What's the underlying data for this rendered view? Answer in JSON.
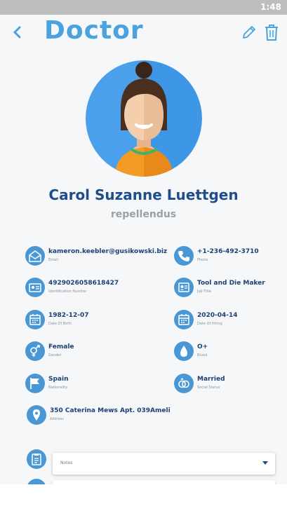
{
  "status_bar": {
    "time": "1:48"
  },
  "header": {
    "title": "Doctor"
  },
  "profile": {
    "name": "Carol Suzanne Luettgen",
    "role": "repellendus"
  },
  "fields": {
    "email": {
      "value": "kameron.keebler@gusikowski.biz",
      "label": "Email"
    },
    "phone": {
      "value": "+1-236-492-3710",
      "label": "Phone"
    },
    "id_number": {
      "value": "4929026058618427",
      "label": "Identification Number"
    },
    "job_title": {
      "value": "Tool and Die Maker",
      "label": "Job Title"
    },
    "dob": {
      "value": "1982-12-07",
      "label": "Date Of Birth"
    },
    "hiring": {
      "value": "2020-04-14",
      "label": "Date Of Hiring"
    },
    "gender": {
      "value": "Female",
      "label": "Gender"
    },
    "blood": {
      "value": "O+",
      "label": "Blood"
    },
    "nationality": {
      "value": "Spain",
      "label": "Nationality"
    },
    "social": {
      "value": "Married",
      "label": "Social Status"
    },
    "address": {
      "value": "350 Caterina Mews Apt. 039Ameli",
      "label": "Address"
    }
  },
  "notes": {
    "label": "Notes"
  },
  "colors": {
    "accent": "#4a97d6",
    "title": "#4aa3dd",
    "name": "#1e4d8c"
  },
  "icons": [
    "back-arrow-icon",
    "pencil-icon",
    "trash-icon",
    "email-icon",
    "phone-icon",
    "id-card-icon",
    "badge-icon",
    "calendar-icon",
    "gender-icon",
    "blood-drop-icon",
    "flag-icon",
    "rings-icon",
    "location-pin-icon",
    "notes-icon",
    "chevron-down-icon"
  ]
}
